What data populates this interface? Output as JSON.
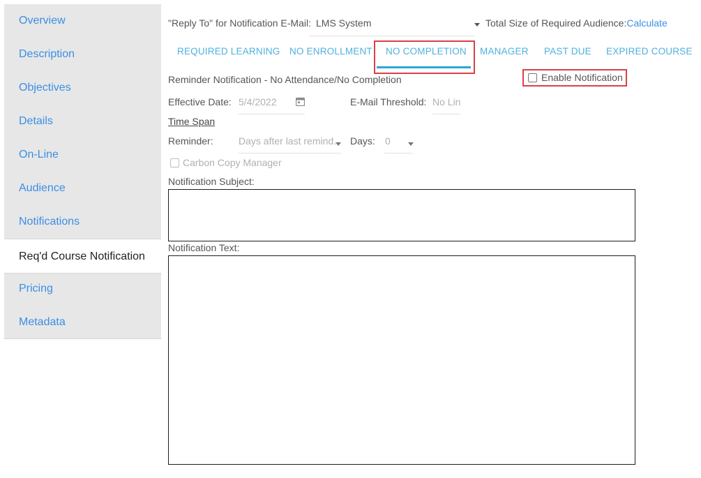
{
  "sidebar": {
    "items": [
      {
        "label": "Overview"
      },
      {
        "label": "Description"
      },
      {
        "label": "Objectives"
      },
      {
        "label": "Details"
      },
      {
        "label": "On-Line"
      },
      {
        "label": "Audience"
      },
      {
        "label": "Notifications"
      },
      {
        "label": "Req'd Course Notification"
      },
      {
        "label": "Pricing"
      },
      {
        "label": "Metadata"
      }
    ],
    "active": "Req'd Course Notification"
  },
  "header": {
    "reply_to_label": "\"Reply To\" for Notification E-Mail:",
    "reply_to_value": "LMS System",
    "audience_label": "Total Size of Required Audience:",
    "audience_link": "Calculate"
  },
  "tabs": [
    {
      "label": "REQUIRED LEARNING"
    },
    {
      "label": "NO ENROLLMENT"
    },
    {
      "label": "NO COMPLETION"
    },
    {
      "label": "MANAGER"
    },
    {
      "label": "PAST DUE"
    },
    {
      "label": "EXPIRED COURSE"
    }
  ],
  "active_tab": "NO COMPLETION",
  "form": {
    "section_title": "Reminder Notification - No Attendance/No Completion",
    "enable_label": "Enable Notification",
    "enable_checked": false,
    "effective_date_label": "Effective Date:",
    "effective_date_value": "5/4/2022",
    "threshold_label": "E-Mail Threshold:",
    "threshold_value": "No Lin",
    "time_span_label": "Time Span",
    "reminder_label": "Reminder:",
    "reminder_value": "Days after last remind...",
    "days_label": "Days:",
    "days_value": "0",
    "cc_manager_label": "Carbon Copy Manager",
    "cc_manager_checked": false,
    "subject_label": "Notification Subject:",
    "text_label": "Notification Text:"
  },
  "colors": {
    "link": "#3b8ee6",
    "tab": "#4fb0e0",
    "tab_active_bar": "#2aa7d6",
    "highlight_box": "#d9404a",
    "sidebar_bg": "#e7e7e7"
  }
}
